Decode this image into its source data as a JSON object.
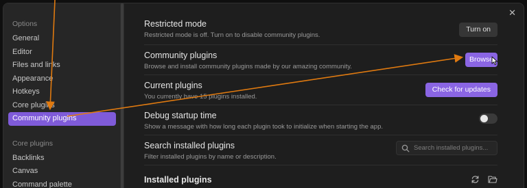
{
  "window": {
    "close_glyph": "✕"
  },
  "sidebar": {
    "options_heading": "Options",
    "options_items": [
      {
        "label": "General"
      },
      {
        "label": "Editor"
      },
      {
        "label": "Files and links"
      },
      {
        "label": "Appearance"
      },
      {
        "label": "Hotkeys"
      },
      {
        "label": "Core plugins"
      },
      {
        "label": "Community plugins",
        "active": true
      }
    ],
    "core_heading": "Core plugins",
    "core_items": [
      {
        "label": "Backlinks"
      },
      {
        "label": "Canvas"
      },
      {
        "label": "Command palette"
      }
    ]
  },
  "settings": {
    "restricted": {
      "title": "Restricted mode",
      "desc": "Restricted mode is off. Turn on to disable community plugins.",
      "button": "Turn on"
    },
    "community": {
      "title": "Community plugins",
      "desc": "Browse and install community plugins made by our amazing community.",
      "button": "Browse"
    },
    "current": {
      "title": "Current plugins",
      "desc": "You currently have 15 plugins installed.",
      "button": "Check for updates"
    },
    "debug": {
      "title": "Debug startup time",
      "desc": "Show a message with how long each plugin took to initialize when starting the app.",
      "toggle_on": false
    },
    "search": {
      "title": "Search installed plugins",
      "desc": "Filter installed plugins by name or description.",
      "placeholder": "Search installed plugins..."
    },
    "installed": {
      "title": "Installed plugins"
    }
  },
  "colors": {
    "accent": "#8a65e3",
    "annotation_arrow": "#e07a10"
  }
}
